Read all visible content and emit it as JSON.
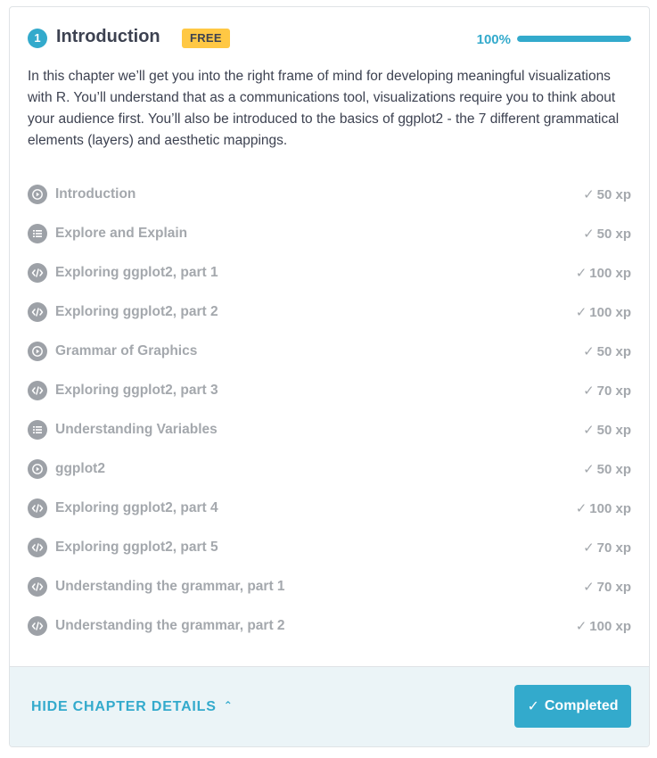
{
  "chapter": {
    "number": "1",
    "title": "Introduction",
    "badge": "FREE",
    "progress_text": "100%",
    "progress_fraction": 1.0,
    "description": "In this chapter we’ll get you into the right frame of mind for developing meaningful visualizations with R. You’ll understand that as a communications tool, visualizations require you to think about your audience first. You’ll also be introduced to the basics of ggplot2 - the 7 different grammatical elements (layers) and aesthetic mappings."
  },
  "exercises": [
    {
      "icon": "video-icon",
      "title": "Introduction",
      "check": "✓",
      "xp": "50 xp"
    },
    {
      "icon": "list-icon",
      "title": "Explore and Explain",
      "check": "✓",
      "xp": "50 xp"
    },
    {
      "icon": "code-icon",
      "title": "Exploring ggplot2, part 1",
      "check": "✓",
      "xp": "100 xp"
    },
    {
      "icon": "code-icon",
      "title": "Exploring ggplot2, part 2",
      "check": "✓",
      "xp": "100 xp"
    },
    {
      "icon": "video-icon",
      "title": "Grammar of Graphics",
      "check": "✓",
      "xp": "50 xp"
    },
    {
      "icon": "code-icon",
      "title": "Exploring ggplot2, part 3",
      "check": "✓",
      "xp": "70 xp"
    },
    {
      "icon": "list-icon",
      "title": "Understanding Variables",
      "check": "✓",
      "xp": "50 xp"
    },
    {
      "icon": "video-icon",
      "title": "ggplot2",
      "check": "✓",
      "xp": "50 xp"
    },
    {
      "icon": "code-icon",
      "title": "Exploring ggplot2, part 4",
      "check": "✓",
      "xp": "100 xp"
    },
    {
      "icon": "code-icon",
      "title": "Exploring ggplot2, part 5",
      "check": "✓",
      "xp": "70 xp"
    },
    {
      "icon": "code-icon",
      "title": "Understanding the grammar, part 1",
      "check": "✓",
      "xp": "70 xp"
    },
    {
      "icon": "code-icon",
      "title": "Understanding the grammar, part 2",
      "check": "✓",
      "xp": "100 xp"
    }
  ],
  "footer": {
    "hide_details_label": "HIDE CHAPTER DETAILS",
    "hide_details_icon": "chevron-up-icon",
    "completed_label": "Completed",
    "completed_icon": "checkmark-icon"
  },
  "colors": {
    "accent": "#33aacc",
    "badge": "#ffc844",
    "muted_text": "#a4a8ad",
    "icon_bg": "#9da1a7",
    "footer_bg": "#ebf4f7",
    "body_text": "#3d4251"
  }
}
